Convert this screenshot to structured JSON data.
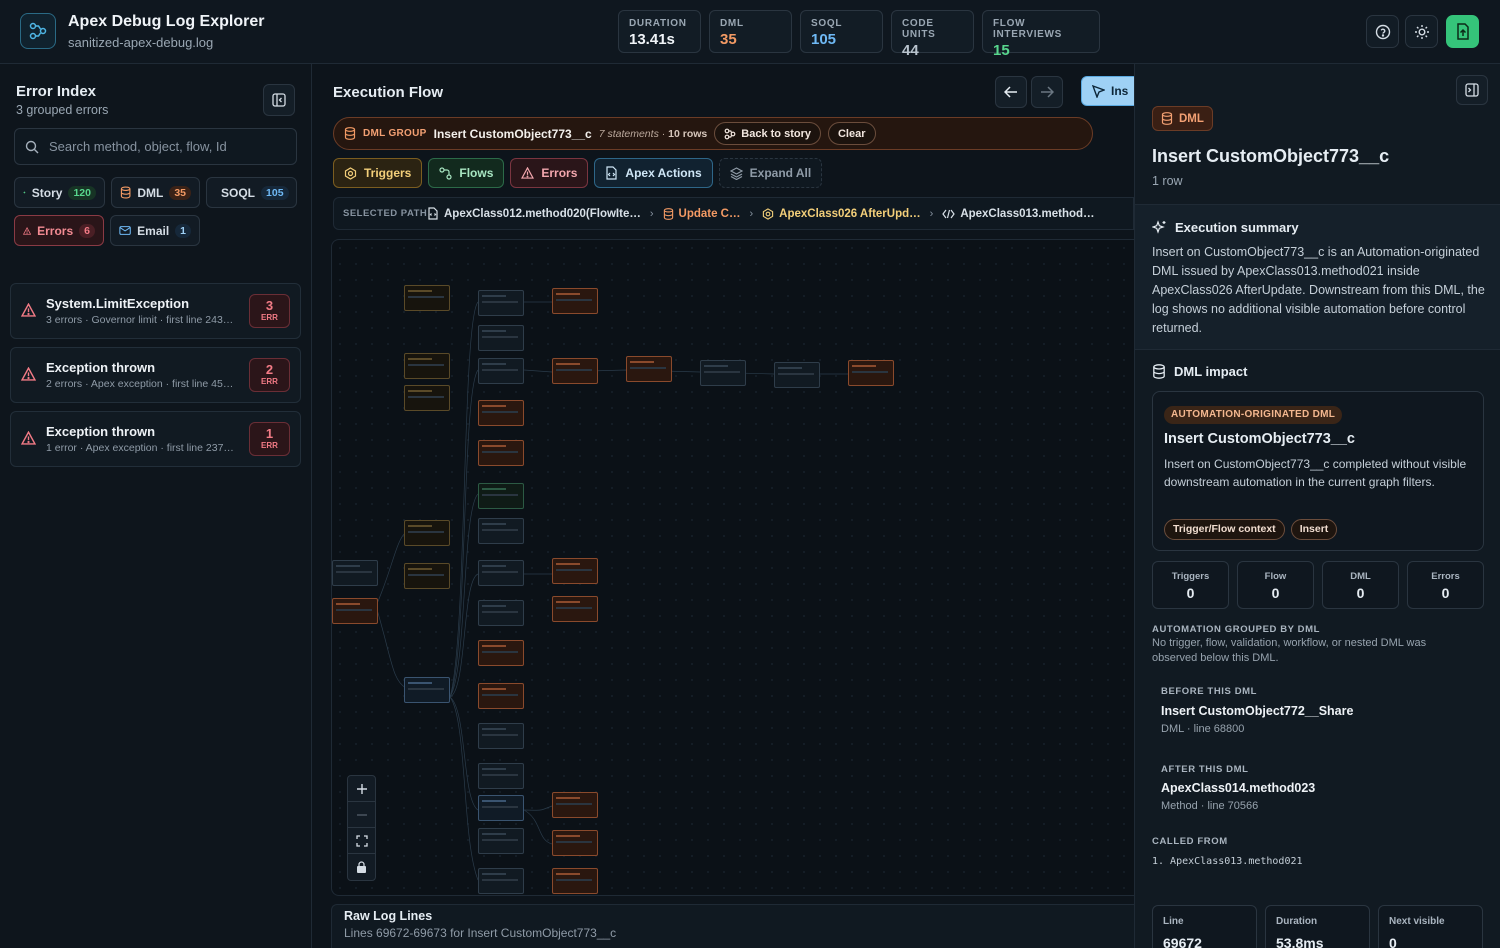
{
  "app": {
    "title": "Apex Debug Log Explorer",
    "file": "sanitized-apex-debug.log"
  },
  "metrics": [
    {
      "label": "DURATION",
      "value": "13.41s",
      "color": "#f0f4f8"
    },
    {
      "label": "DML",
      "value": "35",
      "color": "#f39a64"
    },
    {
      "label": "SOQL",
      "value": "105",
      "color": "#6fb9f5"
    },
    {
      "label": "CODE UNITS",
      "value": "44",
      "color": "#b8c3cd"
    },
    {
      "label": "FLOW INTERVIEWS",
      "value": "15",
      "color": "#58d68d"
    }
  ],
  "left": {
    "title": "Error Index",
    "subtitle": "3 grouped errors",
    "search_placeholder": "Search method, object, flow, Id",
    "filters": [
      {
        "label": "Story",
        "count": "120",
        "icon": "sparkle-icon"
      },
      {
        "label": "DML",
        "count": "35",
        "icon": "database-icon"
      },
      {
        "label": "SOQL",
        "count": "105",
        "icon": "query-icon"
      },
      {
        "label": "Errors",
        "count": "6",
        "icon": "warning-icon"
      },
      {
        "label": "Email",
        "count": "1",
        "icon": "mail-icon"
      }
    ],
    "errors": [
      {
        "name": "System.LimitException",
        "meta": "3 errors · Governor limit · first line 243…",
        "count": "3",
        "unit": "ERR"
      },
      {
        "name": "Exception thrown",
        "meta": "2 errors · Apex exception · first line 45…",
        "count": "2",
        "unit": "ERR"
      },
      {
        "name": "Exception thrown",
        "meta": "1 error · Apex exception · first line 237…",
        "count": "1",
        "unit": "ERR"
      }
    ]
  },
  "center": {
    "title": "Execution Flow",
    "inspect_label": "Ins",
    "dml_group": {
      "tag": "DML GROUP",
      "object": "Insert CustomObject773__c",
      "statements": "7 statements",
      "rows": "10 rows",
      "back_label": "Back to story",
      "clear_label": "Clear"
    },
    "toggles": [
      {
        "label": "Triggers",
        "icon": "trigger-icon"
      },
      {
        "label": "Flows",
        "icon": "flow-icon"
      },
      {
        "label": "Errors",
        "icon": "warning-icon"
      },
      {
        "label": "Apex Actions",
        "icon": "apex-action-icon"
      },
      {
        "label": "Expand All",
        "icon": "layers-icon"
      }
    ],
    "path_label": "SELECTED PATH",
    "path": [
      {
        "label": "ApexClass012.method020(FlowIte…",
        "icon": "flow-file-icon"
      },
      {
        "label": "Update C…",
        "icon": "database-icon"
      },
      {
        "label": "ApexClass026 AfterUpd…",
        "icon": "trigger-icon"
      },
      {
        "label": "ApexClass013.method…",
        "icon": "code-icon"
      }
    ],
    "raw": {
      "title": "Raw Log Lines",
      "subtitle": "Lines 69672-69673 for Insert CustomObject773__c"
    }
  },
  "right": {
    "badge": "DML",
    "title": "Insert CustomObject773__c",
    "subtitle": "1 row",
    "summary_title": "Execution summary",
    "summary_text": "Insert on CustomObject773__c is an Automation-originated DML issued by ApexClass013.method021 inside ApexClass026 AfterUpdate. Downstream from this DML, the log shows no additional visible automation before control returned.",
    "impact_title": "DML impact",
    "impact_badge": "AUTOMATION-ORIGINATED DML",
    "impact_heading": "Insert CustomObject773__c",
    "impact_desc": "Insert on CustomObject773__c completed without visible downstream automation in the current graph filters.",
    "impact_tags": [
      "Trigger/Flow context",
      "Insert"
    ],
    "stats": [
      {
        "label": "Triggers",
        "value": "0"
      },
      {
        "label": "Flow",
        "value": "0"
      },
      {
        "label": "DML",
        "value": "0"
      },
      {
        "label": "Errors",
        "value": "0"
      }
    ],
    "grouped_title": "AUTOMATION GROUPED BY DML",
    "grouped_desc": "No trigger, flow, validation, workflow, or nested DML was observed below this DML.",
    "before_label": "BEFORE THIS DML",
    "before_name": "Insert CustomObject772__Share",
    "before_meta": "DML · line 68800",
    "after_label": "AFTER THIS DML",
    "after_name": "ApexClass014.method023",
    "after_meta": "Method · line 70566",
    "called_label": "CALLED FROM",
    "called_item": "1. ApexClass013.method021",
    "bottom": [
      {
        "label": "Line",
        "value": "69672"
      },
      {
        "label": "Duration",
        "value": "53.8ms"
      },
      {
        "label": "Next visible",
        "value": "0"
      }
    ]
  }
}
